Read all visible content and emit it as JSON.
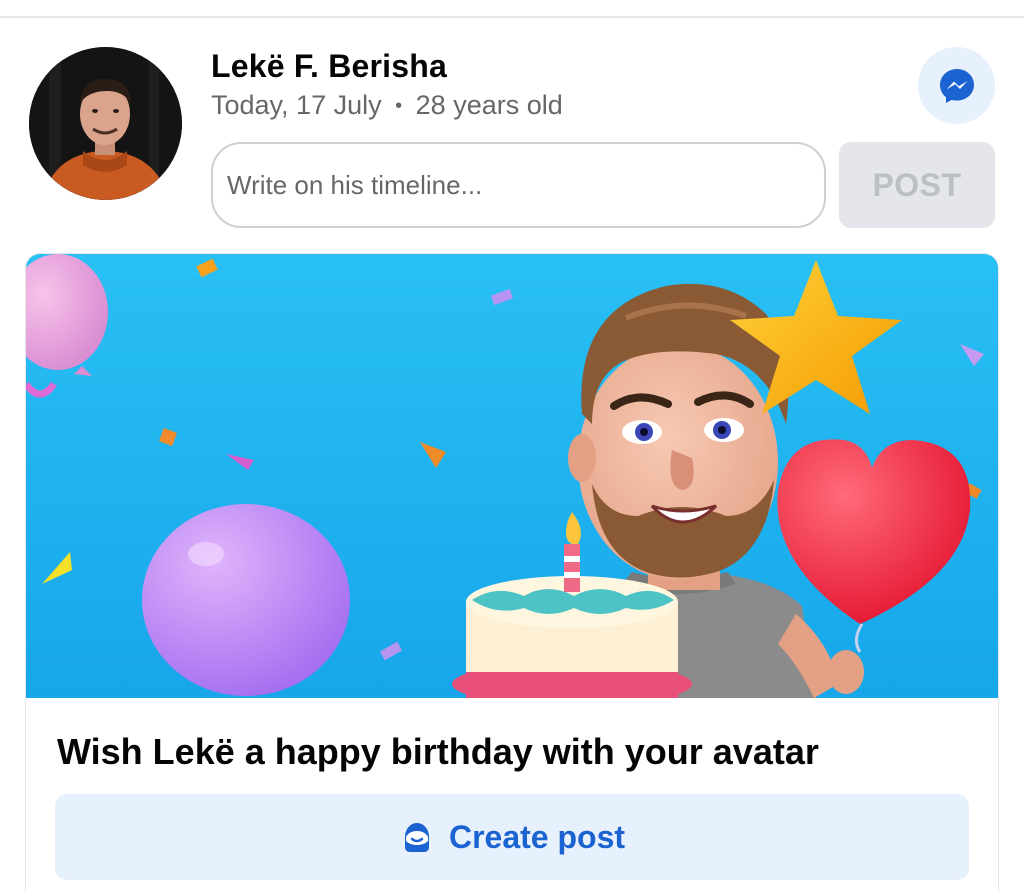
{
  "profile": {
    "name": "Lekë F. Berisha",
    "date": "Today, 17 July",
    "separator": "•",
    "age": "28 years old"
  },
  "composer": {
    "placeholder": "Write on his timeline...",
    "post_label": "POST"
  },
  "card": {
    "title": "Wish Lekë a happy birthday with your avatar",
    "button_label": "Create post",
    "button_icon": "avatar-sticker-icon"
  },
  "icons": {
    "messenger": "messenger-icon"
  },
  "colors": {
    "accent": "#1b63d1",
    "accent_bg": "#e7f0fd",
    "secondary_text": "#65676b",
    "banner_bg": "#1fb3f0"
  }
}
